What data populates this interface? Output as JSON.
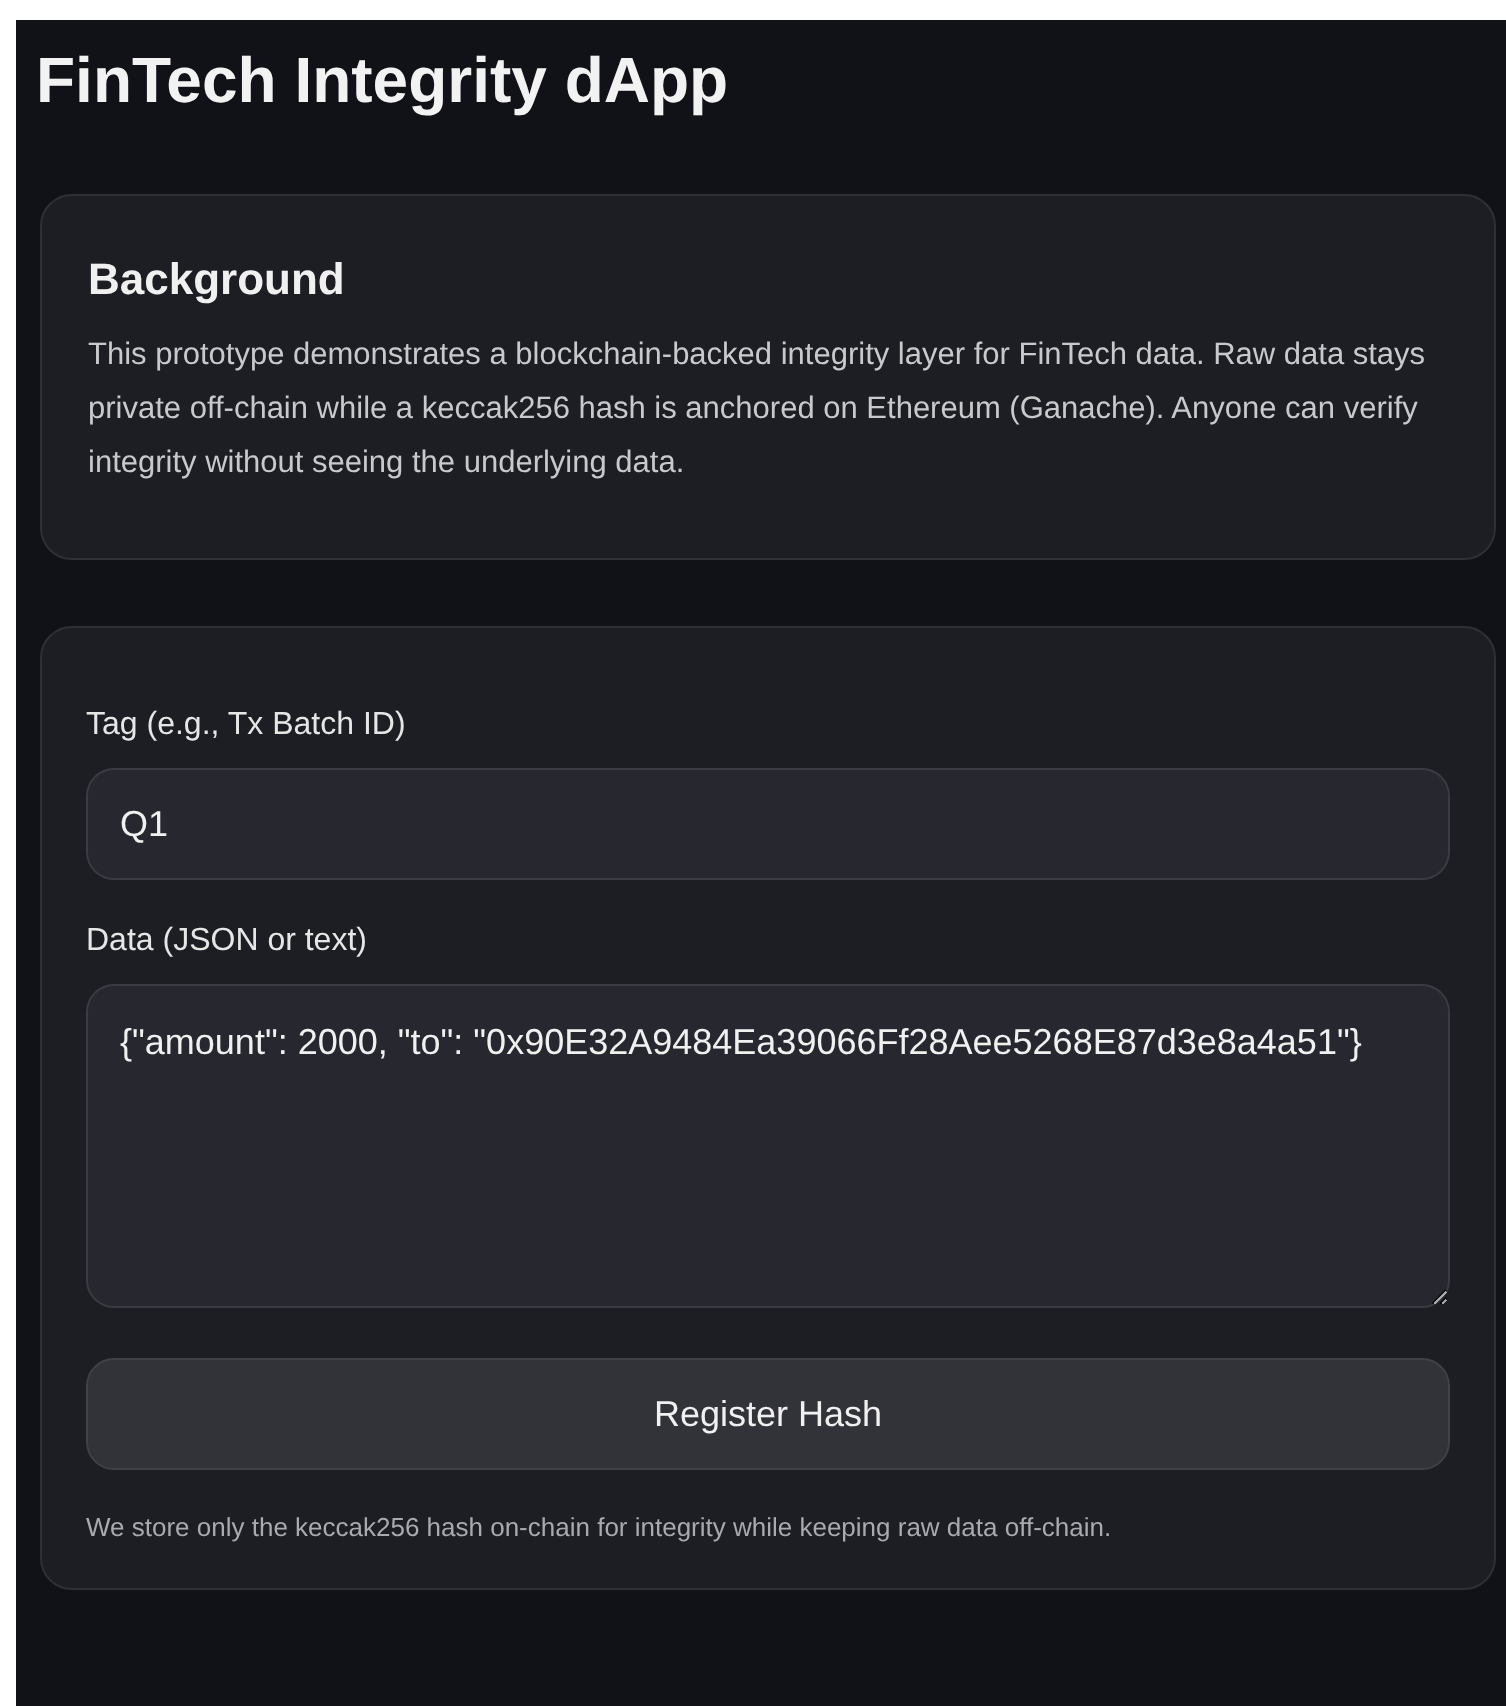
{
  "title": "FinTech Integrity dApp",
  "background": {
    "heading": "Background",
    "text": "This prototype demonstrates a blockchain-backed integrity layer for FinTech data. Raw data stays private off-chain while a keccak256 hash is anchored on Ethereum (Ganache). Anyone can verify integrity without seeing the underlying data."
  },
  "form": {
    "fields": [
      {
        "kind": "input",
        "label": "Tag (e.g., Tx Batch ID)",
        "value": "Q1"
      },
      {
        "kind": "textarea",
        "label": "Data (JSON or text)",
        "value": "{\"amount\": 2000, \"to\": \"0x90E32A9484Ea39066Ff28Aee5268E87d3e8a4a51\"}"
      }
    ],
    "button": "Register Hash",
    "note": "We store only the keccak256 hash on-chain for integrity while keeping raw data off-chain."
  }
}
